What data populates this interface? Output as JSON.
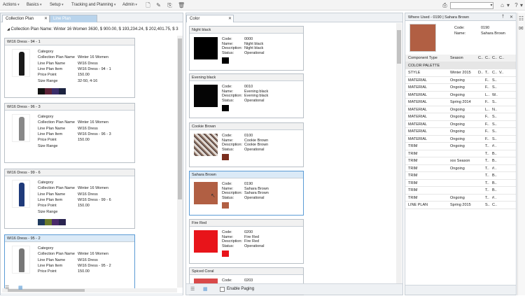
{
  "menubar": {
    "items": [
      {
        "label": "Actions"
      },
      {
        "label": "Basics"
      },
      {
        "label": "Setup"
      },
      {
        "label": "Tracking and Planning"
      },
      {
        "label": "Admin"
      }
    ]
  },
  "left": {
    "tabs": [
      {
        "label": "Collection Plan"
      },
      {
        "label": "Line Plan"
      }
    ],
    "header": {
      "label": "Collection Plan Name:",
      "name": "Winter 16 Women",
      "values": "3630,  $ 900.00,  $ 193,234.24,  $ 202,401.75,  $ 3"
    },
    "cards": [
      {
        "title": "WI16 Dress - 94 - 1",
        "fields": [
          [
            "Category",
            ""
          ],
          [
            "Collection Plan Name",
            "Winter 16 Women"
          ],
          [
            "Line Plan Name",
            "WI16 Dress"
          ],
          [
            "Line Plan Item",
            "WI16 Dress - 94 - 1"
          ],
          [
            "Price Point",
            "150.00"
          ],
          [
            "Size Range",
            "32-50, 4-16"
          ]
        ],
        "swatches": [
          "#121212",
          "#5e2338",
          "#3a2e6a",
          "#1c2340"
        ]
      },
      {
        "title": "WI16 Dress - 96 - 3",
        "fields": [
          [
            "Category",
            ""
          ],
          [
            "Collection Plan Name",
            "Winter 16 Women"
          ],
          [
            "Line Plan Name",
            "WI16 Dress"
          ],
          [
            "Line Plan Item",
            "WI16 Dress - 96 - 3"
          ],
          [
            "Price Point",
            "150.00"
          ],
          [
            "Size Range",
            ""
          ]
        ],
        "swatches": []
      },
      {
        "title": "WI16 Dress - 99 - 6",
        "fields": [
          [
            "Category",
            ""
          ],
          [
            "Collection Plan Name",
            "Winter 16 Women"
          ],
          [
            "Line Plan Name",
            "WI16 Dress"
          ],
          [
            "Line Plan Item",
            "WI16 Dress - 99 - 6"
          ],
          [
            "Price Point",
            "150.00"
          ],
          [
            "Size Range",
            ""
          ]
        ],
        "swatches": [
          "#1f3a5e",
          "#6b7a2a",
          "#4a2a6a",
          "#2a2450"
        ]
      },
      {
        "title": "WI16 Dress - 95 - 2",
        "fields": [
          [
            "Category",
            ""
          ],
          [
            "Collection Plan Name",
            "Winter 16 Women"
          ],
          [
            "Line Plan Name",
            "WI16 Dress"
          ],
          [
            "Line Plan Item",
            "WI16 Dress - 95 - 2"
          ],
          [
            "Price Point",
            "150.00"
          ]
        ],
        "swatches": []
      }
    ]
  },
  "middle": {
    "tab": {
      "label": "Color"
    },
    "paging_label": "Enable Paging",
    "field_labels": {
      "code": "Code:",
      "name": "Name:",
      "description": "Description:",
      "status": "Status:"
    },
    "cards": [
      {
        "title": "Night black",
        "code": "0000",
        "name": "Night black",
        "description": "Night black",
        "status": "Operational",
        "color": "#000000",
        "swatch": "#000000"
      },
      {
        "title": "Evening black",
        "code": "0010",
        "name": "Evening black",
        "description": "Evening black",
        "status": "Operational",
        "color": "#050505",
        "swatch": "#000000"
      },
      {
        "title": "Cookie Brown",
        "code": "0100",
        "name": "Cookie Brown",
        "description": "Cookie Brown",
        "status": "Operational",
        "color": "pattern",
        "swatch": "#7a2e1e"
      },
      {
        "title": "Sahara Brown",
        "code": "0190",
        "name": "Sahara Brown",
        "description": "Sahara Brown",
        "status": "Operational",
        "color": "#b15f43",
        "swatch": "#b15f43"
      },
      {
        "title": "Fire Red",
        "code": "0200",
        "name": "Fire Red",
        "description": "Fire Red",
        "status": "Operational",
        "color": "#e8141a",
        "swatch": "#e8141a"
      },
      {
        "title": "Spiced Coral",
        "code": "0203",
        "name": "",
        "description": "",
        "status": "",
        "color": "#d94a4a",
        "swatch": "#d94a4a"
      }
    ]
  },
  "right": {
    "title": "Where Used - 0190 | Sahara Brown",
    "code_label": "Code:",
    "code": "0190",
    "name_label": "Name:",
    "name": "Sahara Brown",
    "swatch": "#b15f43",
    "columns": [
      "Component Type",
      "Season",
      "C..",
      "C..",
      "C..",
      "C.."
    ],
    "rows": [
      [
        "COLOR PALETTE",
        "",
        "",
        "",
        "",
        ""
      ],
      [
        "STYLE",
        "Winter 2015",
        "D..",
        "T..",
        "C..",
        "V.."
      ],
      [
        "MATERIAL",
        "Ongoing",
        "",
        "F..",
        "S..",
        ""
      ],
      [
        "MATERIAL",
        "Ongoing",
        "",
        "F..",
        "S..",
        ""
      ],
      [
        "MATERIAL",
        "Ongoing",
        "",
        "L..",
        "W..",
        ""
      ],
      [
        "MATERIAL",
        "Spring 2014",
        "",
        "F..",
        "S..",
        ""
      ],
      [
        "MATERIAL",
        "Ongoing",
        "",
        "L..",
        "N..",
        ""
      ],
      [
        "MATERIAL",
        "Ongoing",
        "",
        "F..",
        "S..",
        ""
      ],
      [
        "MATERIAL",
        "Ongoing",
        "",
        "F..",
        "S..",
        ""
      ],
      [
        "MATERIAL",
        "Ongoing",
        "",
        "F..",
        "S..",
        ""
      ],
      [
        "MATERIAL",
        "Ongoing",
        "",
        "F..",
        "S..",
        ""
      ],
      [
        "TRIM",
        "Ongoing",
        "",
        "T..",
        "#..",
        ""
      ],
      [
        "TRIM",
        "",
        "",
        "T..",
        "B..",
        ""
      ],
      [
        "TRIM",
        "xxx Season",
        "",
        "T..",
        "B..",
        ""
      ],
      [
        "TRIM",
        "Ongoing",
        "",
        "T..",
        "#..",
        ""
      ],
      [
        "TRIM",
        "",
        "",
        "T..",
        "B..",
        ""
      ],
      [
        "TRIM",
        "",
        "",
        "T..",
        "B..",
        ""
      ],
      [
        "TRIM",
        "",
        "",
        "T..",
        "B..",
        ""
      ],
      [
        "TRIM",
        "Ongoing",
        "",
        "T..",
        "#..",
        ""
      ],
      [
        "LINE PLAN",
        "Spring 2015",
        "",
        "S..",
        "C..",
        ""
      ]
    ]
  }
}
